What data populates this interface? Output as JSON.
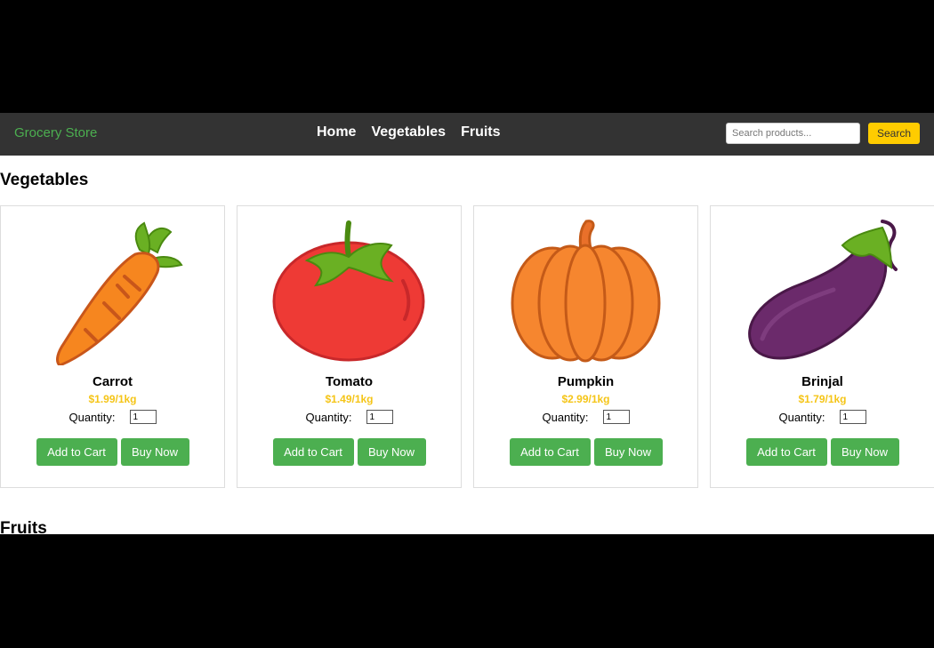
{
  "navbar": {
    "brand": "Grocery Store",
    "links": [
      "Home",
      "Vegetables",
      "Fruits"
    ],
    "search_placeholder": "Search products...",
    "search_button": "Search"
  },
  "sections": {
    "vegetables": "Vegetables",
    "fruits": "Fruits"
  },
  "products": [
    {
      "name": "Carrot",
      "price": "$1.99/1kg",
      "quantity_label": "Quantity:",
      "quantity": "1",
      "add_label": "Add to Cart",
      "buy_label": "Buy Now",
      "icon": "carrot-icon"
    },
    {
      "name": "Tomato",
      "price": "$1.49/1kg",
      "quantity_label": "Quantity:",
      "quantity": "1",
      "add_label": "Add to Cart",
      "buy_label": "Buy Now",
      "icon": "tomato-icon"
    },
    {
      "name": "Pumpkin",
      "price": "$2.99/1kg",
      "quantity_label": "Quantity:",
      "quantity": "1",
      "add_label": "Add to Cart",
      "buy_label": "Buy Now",
      "icon": "pumpkin-icon"
    },
    {
      "name": "Brinjal",
      "price": "$1.79/1kg",
      "quantity_label": "Quantity:",
      "quantity": "1",
      "add_label": "Add to Cart",
      "buy_label": "Buy Now",
      "icon": "brinjal-icon"
    }
  ],
  "colors": {
    "navbar_bg": "#333333",
    "brand": "#4caf50",
    "price": "#f5c518",
    "button": "#4caf50",
    "search_button": "#ffcc00"
  }
}
